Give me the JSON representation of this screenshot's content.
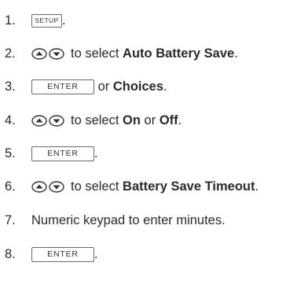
{
  "steps": [
    {
      "number": "1.",
      "key": "SETUP",
      "suffix": "."
    },
    {
      "number": "2.",
      "text_pre": "to select ",
      "bold": "Auto Battery Save",
      "suffix": "."
    },
    {
      "number": "3.",
      "key": "ENTER",
      "text_pre": " or ",
      "bold": "Choices",
      "suffix": "."
    },
    {
      "number": "4.",
      "text_pre": "to select ",
      "bold": "On",
      "text_mid": " or ",
      "bold2": "Off",
      "suffix": "."
    },
    {
      "number": "5.",
      "key": "ENTER",
      "suffix": "."
    },
    {
      "number": "6.",
      "text_pre": "to select ",
      "bold": "Battery Save Timeout",
      "suffix": "."
    },
    {
      "number": "7.",
      "text": "Numeric keypad to enter minutes."
    },
    {
      "number": "8.",
      "key": "ENTER",
      "suffix": "."
    }
  ],
  "icons": {
    "up": "up-arrow-icon",
    "down": "down-arrow-icon"
  }
}
